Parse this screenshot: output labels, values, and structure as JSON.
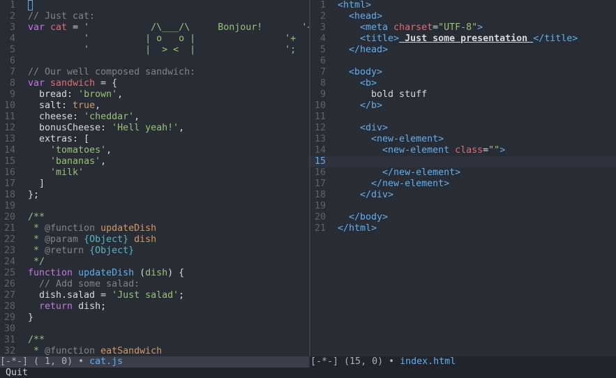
{
  "left_pane": {
    "lines": [
      {
        "n": "1",
        "tokens": []
      },
      {
        "n": "2",
        "tokens": [
          {
            "t": "// Just cat:",
            "c": "comment"
          }
        ]
      },
      {
        "n": "3",
        "tokens": [
          {
            "t": "var",
            "c": "keyword"
          },
          {
            "t": " ",
            "c": "plain"
          },
          {
            "t": "cat",
            "c": "var"
          },
          {
            "t": " = ",
            "c": "plain"
          },
          {
            "t": "'           /\\___/\\     Bonjour!       '+",
            "c": "string"
          }
        ]
      },
      {
        "n": "4",
        "tokens": [
          {
            "t": "          '          | o   o |                '+",
            "c": "string"
          }
        ]
      },
      {
        "n": "5",
        "tokens": [
          {
            "t": "          '          |  > <  |                ';",
            "c": "string"
          }
        ]
      },
      {
        "n": "6",
        "tokens": []
      },
      {
        "n": "7",
        "tokens": [
          {
            "t": "// Our well composed sandwich:",
            "c": "comment"
          }
        ]
      },
      {
        "n": "8",
        "tokens": [
          {
            "t": "var",
            "c": "keyword"
          },
          {
            "t": " ",
            "c": "plain"
          },
          {
            "t": "sandwich",
            "c": "var"
          },
          {
            "t": " = {",
            "c": "plain"
          }
        ]
      },
      {
        "n": "9",
        "tokens": [
          {
            "t": "  bread: ",
            "c": "plain"
          },
          {
            "t": "'brown'",
            "c": "string"
          },
          {
            "t": ",",
            "c": "plain"
          }
        ]
      },
      {
        "n": "10",
        "tokens": [
          {
            "t": "  salt: ",
            "c": "plain"
          },
          {
            "t": "true",
            "c": "bool"
          },
          {
            "t": ",",
            "c": "plain"
          }
        ]
      },
      {
        "n": "11",
        "tokens": [
          {
            "t": "  cheese: ",
            "c": "plain"
          },
          {
            "t": "'cheddar'",
            "c": "string"
          },
          {
            "t": ",",
            "c": "plain"
          }
        ]
      },
      {
        "n": "12",
        "tokens": [
          {
            "t": "  bonusCheese: ",
            "c": "plain"
          },
          {
            "t": "'Hell yeah!'",
            "c": "string"
          },
          {
            "t": ",",
            "c": "plain"
          }
        ]
      },
      {
        "n": "13",
        "tokens": [
          {
            "t": "  extras: [",
            "c": "plain"
          }
        ]
      },
      {
        "n": "14",
        "tokens": [
          {
            "t": "    ",
            "c": "plain"
          },
          {
            "t": "'tomatoes'",
            "c": "string"
          },
          {
            "t": ",",
            "c": "plain"
          }
        ]
      },
      {
        "n": "15",
        "tokens": [
          {
            "t": "    ",
            "c": "plain"
          },
          {
            "t": "'bananas'",
            "c": "string"
          },
          {
            "t": ",",
            "c": "plain"
          }
        ]
      },
      {
        "n": "16",
        "tokens": [
          {
            "t": "    ",
            "c": "plain"
          },
          {
            "t": "'milk'",
            "c": "string"
          }
        ]
      },
      {
        "n": "17",
        "tokens": [
          {
            "t": "  ]",
            "c": "plain"
          }
        ]
      },
      {
        "n": "18",
        "tokens": [
          {
            "t": "};",
            "c": "plain"
          }
        ]
      },
      {
        "n": "19",
        "tokens": []
      },
      {
        "n": "20",
        "tokens": [
          {
            "t": "/**",
            "c": "doc"
          }
        ]
      },
      {
        "n": "21",
        "tokens": [
          {
            "t": " * ",
            "c": "doc"
          },
          {
            "t": "@function",
            "c": "comment"
          },
          {
            "t": " ",
            "c": "plain"
          },
          {
            "t": "updateDish",
            "c": "bool"
          }
        ]
      },
      {
        "n": "22",
        "tokens": [
          {
            "t": " * ",
            "c": "doc"
          },
          {
            "t": "@param",
            "c": "comment"
          },
          {
            "t": " {Object}",
            "c": "type"
          },
          {
            "t": " dish",
            "c": "bool"
          }
        ]
      },
      {
        "n": "23",
        "tokens": [
          {
            "t": " * ",
            "c": "doc"
          },
          {
            "t": "@return",
            "c": "comment"
          },
          {
            "t": " {Object}",
            "c": "type"
          }
        ]
      },
      {
        "n": "24",
        "tokens": [
          {
            "t": " */",
            "c": "doc"
          }
        ]
      },
      {
        "n": "25",
        "tokens": [
          {
            "t": "function",
            "c": "keyword"
          },
          {
            "t": " ",
            "c": "plain"
          },
          {
            "t": "updateDish",
            "c": "func"
          },
          {
            "t": " (",
            "c": "plain"
          },
          {
            "t": "dish",
            "c": "param"
          },
          {
            "t": ") {",
            "c": "plain"
          }
        ]
      },
      {
        "n": "26",
        "tokens": [
          {
            "t": "  // Add some salad:",
            "c": "comment"
          }
        ]
      },
      {
        "n": "27",
        "tokens": [
          {
            "t": "  dish.salad = ",
            "c": "plain"
          },
          {
            "t": "'Just salad'",
            "c": "string"
          },
          {
            "t": ";",
            "c": "plain"
          }
        ]
      },
      {
        "n": "28",
        "tokens": [
          {
            "t": "  ",
            "c": "plain"
          },
          {
            "t": "return",
            "c": "keyword"
          },
          {
            "t": " dish;",
            "c": "plain"
          }
        ]
      },
      {
        "n": "29",
        "tokens": [
          {
            "t": "}",
            "c": "plain"
          }
        ]
      },
      {
        "n": "30",
        "tokens": []
      },
      {
        "n": "31",
        "tokens": [
          {
            "t": "/**",
            "c": "doc"
          }
        ]
      },
      {
        "n": "32",
        "tokens": [
          {
            "t": " * ",
            "c": "doc"
          },
          {
            "t": "@function",
            "c": "comment"
          },
          {
            "t": " ",
            "c": "plain"
          },
          {
            "t": "eatSandwich",
            "c": "bool"
          }
        ]
      }
    ]
  },
  "right_pane": {
    "current_line": "15",
    "lines": [
      {
        "n": "1",
        "tokens": [
          {
            "t": "<html>",
            "c": "tag"
          }
        ]
      },
      {
        "n": "2",
        "tokens": [
          {
            "t": "  <head>",
            "c": "tag"
          }
        ]
      },
      {
        "n": "3",
        "tokens": [
          {
            "t": "    <meta ",
            "c": "tag"
          },
          {
            "t": "charset",
            "c": "attr"
          },
          {
            "t": "=",
            "c": "plain"
          },
          {
            "t": "\"UTF-8\"",
            "c": "string"
          },
          {
            "t": ">",
            "c": "tag"
          }
        ]
      },
      {
        "n": "4",
        "tokens": [
          {
            "t": "    <title>",
            "c": "tag"
          },
          {
            "t": " Just some presentation ",
            "c": "title"
          },
          {
            "t": "</title>",
            "c": "tag"
          }
        ]
      },
      {
        "n": "5",
        "tokens": [
          {
            "t": "  </head>",
            "c": "tag"
          }
        ]
      },
      {
        "n": "6",
        "tokens": []
      },
      {
        "n": "7",
        "tokens": [
          {
            "t": "  <body>",
            "c": "tag"
          }
        ]
      },
      {
        "n": "8",
        "tokens": [
          {
            "t": "    <b>",
            "c": "tag"
          }
        ]
      },
      {
        "n": "9",
        "tokens": [
          {
            "t": "      bold stuff",
            "c": "plain"
          }
        ]
      },
      {
        "n": "10",
        "tokens": [
          {
            "t": "    </b>",
            "c": "tag"
          }
        ]
      },
      {
        "n": "11",
        "tokens": []
      },
      {
        "n": "12",
        "tokens": [
          {
            "t": "    <div>",
            "c": "tag"
          }
        ]
      },
      {
        "n": "13",
        "tokens": [
          {
            "t": "      <new-element>",
            "c": "tag"
          }
        ]
      },
      {
        "n": "14",
        "tokens": [
          {
            "t": "        <new-element ",
            "c": "tag"
          },
          {
            "t": "class",
            "c": "attr"
          },
          {
            "t": "=",
            "c": "plain"
          },
          {
            "t": "\"\"",
            "c": "string"
          },
          {
            "t": ">",
            "c": "tag"
          }
        ]
      },
      {
        "n": "15",
        "tokens": []
      },
      {
        "n": "16",
        "tokens": [
          {
            "t": "        </new-element>",
            "c": "tag"
          }
        ]
      },
      {
        "n": "17",
        "tokens": [
          {
            "t": "      </new-element>",
            "c": "tag"
          }
        ]
      },
      {
        "n": "18",
        "tokens": [
          {
            "t": "    </div>",
            "c": "tag"
          }
        ]
      },
      {
        "n": "19",
        "tokens": []
      },
      {
        "n": "20",
        "tokens": [
          {
            "t": "  </body>",
            "c": "tag"
          }
        ]
      },
      {
        "n": "21",
        "tokens": [
          {
            "t": "</html>",
            "c": "tag"
          }
        ]
      }
    ]
  },
  "modeline_left": {
    "state": "[-*-]",
    "position": "( 1, 0)",
    "sep": "•",
    "buffer": "cat.js"
  },
  "modeline_right": {
    "state": "[-*-]",
    "position": "(15, 0)",
    "sep": "•",
    "buffer": "index.html"
  },
  "minibuffer": {
    "text": "Quit"
  }
}
